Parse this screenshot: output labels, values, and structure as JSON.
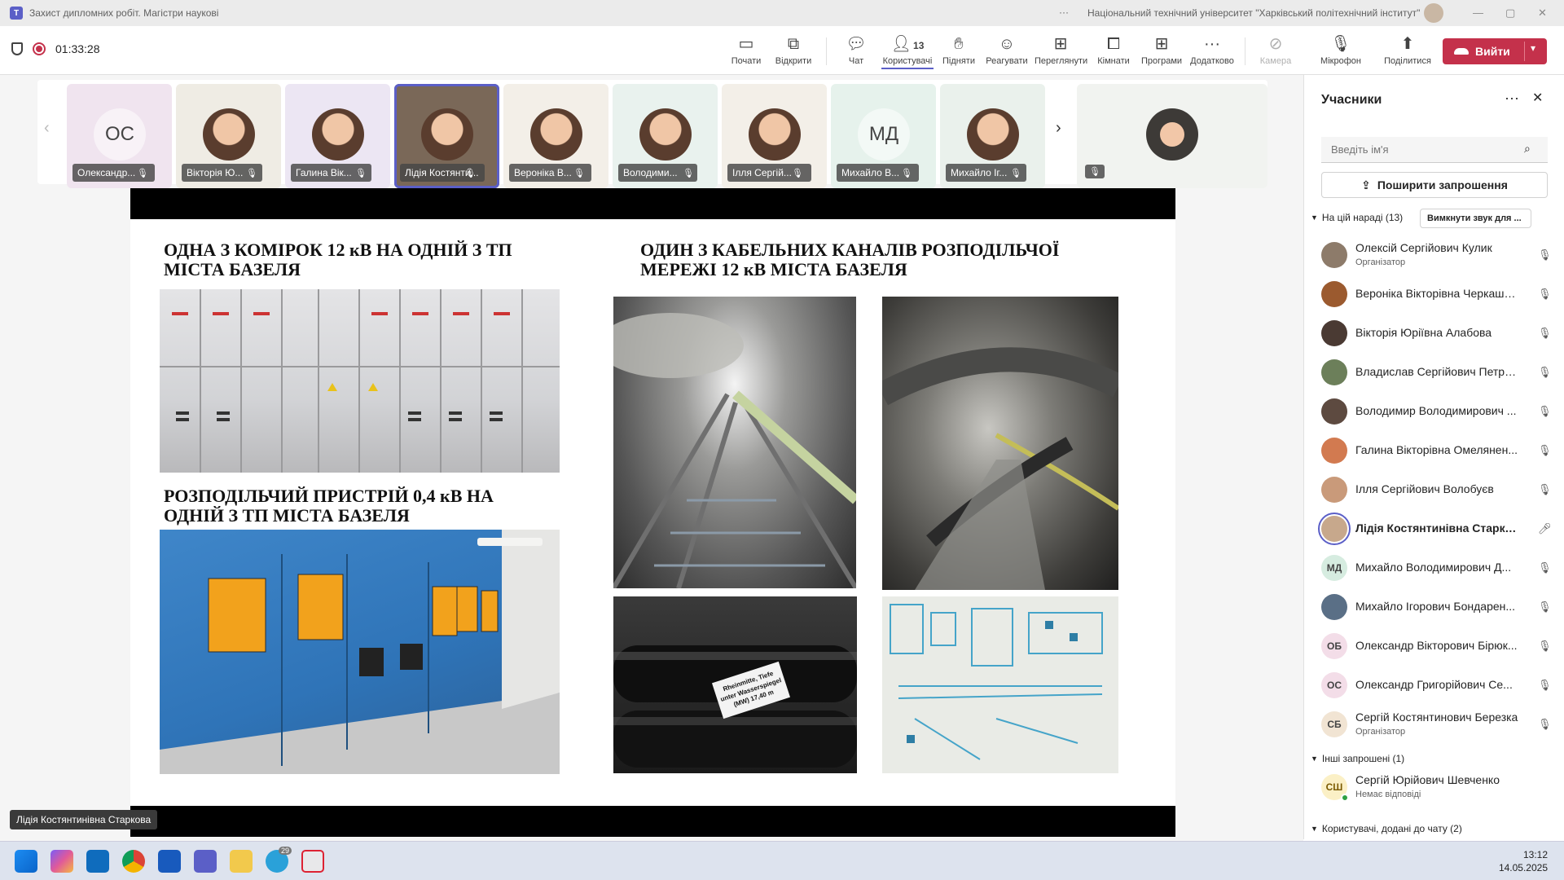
{
  "window": {
    "title": "Захист дипломних робіт. Магістри наукові",
    "org": "Національний технічний університет \"Харківський політехнічний інститут\""
  },
  "meeting": {
    "timer": "01:33:28"
  },
  "toolbar": {
    "start": "Почати",
    "open": "Відкрити",
    "chat": "Чат",
    "people": "Користувачі",
    "people_count": "13",
    "raise": "Підняти",
    "react": "Реагувати",
    "view": "Переглянути",
    "rooms": "Кімнати",
    "apps": "Програми",
    "more": "Додатково",
    "camera": "Камера",
    "mic": "Мікрофон",
    "share": "Поділитися",
    "leave": "Вийти"
  },
  "tiles": [
    {
      "name": "Олександр...",
      "initials": "ОС",
      "bg": "#f0e4ef"
    },
    {
      "name": "Вікторія Ю...",
      "initials": "",
      "bg": "#efece4"
    },
    {
      "name": "Галина Вік...",
      "initials": "",
      "bg": "#ece6f3"
    },
    {
      "name": "Лідія Костянти...",
      "initials": "",
      "bg": "#7a6858"
    },
    {
      "name": "Вероніка В...",
      "initials": "",
      "bg": "#f3efe8"
    },
    {
      "name": "Володими...",
      "initials": "",
      "bg": "#e9f2ee"
    },
    {
      "name": "Ілля Сергій...",
      "initials": "",
      "bg": "#f3efe8"
    },
    {
      "name": "Михайло В...",
      "initials": "МД",
      "bg": "#e6f2ec"
    },
    {
      "name": "Михайло Іг...",
      "initials": "",
      "bg": "#eaf1ec"
    }
  ],
  "slide": {
    "h1": "ОДНА З КОМІРОК 12 кВ НА ОДНІЙ З ТП МІСТА БАЗЕЛЯ",
    "h2": "ОДИН З КАБЕЛЬНИХ КАНАЛІВ РОЗПОДІЛЬЧОЇ МЕРЕЖІ 12 кВ МІСТА БАЗЕЛЯ",
    "h3": "РОЗПОДІЛЬЧИЙ ПРИСТРІЙ 0,4 кВ НА ОДНІЙ З ТП МІСТА БАЗЕЛЯ",
    "sign_l1": "Rheinmitte, Tiefe",
    "sign_l2": "unter Wasserspiegel",
    "sign_l3": "(MW) 17,40 m"
  },
  "speaker": "Лідія Костянтинівна Старкова",
  "panel": {
    "title": "Учасники",
    "search_placeholder": "Введіть ім'я",
    "invite": "Поширити запрошення",
    "in_meeting": "На цій нараді (13)",
    "mute_all": "Вимкнути звук для ...",
    "others": "Інші запрошені (1)",
    "added": "Користувачі, додані до чату (2)",
    "participants": [
      {
        "name": "Олексій Сергійович Кулик",
        "role": "Організатор",
        "initials": "",
        "color": "#8d7b6a"
      },
      {
        "name": "Вероніка Вікторівна Черкашина",
        "role": "",
        "initials": "",
        "color": "#9b5a2f"
      },
      {
        "name": "Вікторія Юріївна Алабова",
        "role": "",
        "initials": "",
        "color": "#4a3a33"
      },
      {
        "name": "Владислав Сергійович Петренко",
        "role": "",
        "initials": "",
        "color": "#6c7f5a"
      },
      {
        "name": "Володимир Володимирович ...",
        "role": "",
        "initials": "",
        "color": "#5d4a40"
      },
      {
        "name": "Галина Вікторівна Омелянен...",
        "role": "",
        "initials": "",
        "color": "#d27a50"
      },
      {
        "name": "Ілля Сергійович Волобуєв",
        "role": "",
        "initials": "",
        "color": "#c99a7a"
      },
      {
        "name": "Лідія Костянтинівна Старкова",
        "role": "",
        "initials": "",
        "color": "#c7a88c"
      },
      {
        "name": "Михайло Володимирович Д...",
        "role": "",
        "initials": "МД",
        "color": "#d6ece0"
      },
      {
        "name": "Михайло Ігорович Бондарен...",
        "role": "",
        "initials": "",
        "color": "#5a6f86"
      },
      {
        "name": "Олександр Вікторович Бірюк...",
        "role": "",
        "initials": "ОБ",
        "color": "#f3dde8"
      },
      {
        "name": "Олександр Григорійович Се...",
        "role": "",
        "initials": "ОС",
        "color": "#f3dde8"
      },
      {
        "name": "Сергій Костянтинович Березка",
        "role": "Організатор",
        "initials": "СБ",
        "color": "#f1e4d3"
      }
    ],
    "invited": {
      "name": "Сергій Юрійович Шевченко",
      "status": "Немає відповіді",
      "initials": "СШ",
      "color": "#fbf0c6"
    }
  },
  "taskbar": {
    "time": "13:12",
    "date": "14.05.2025",
    "telegram_badge": "29"
  },
  "colors": {
    "accent": "#5b5fc7",
    "leave": "#c4314b"
  }
}
